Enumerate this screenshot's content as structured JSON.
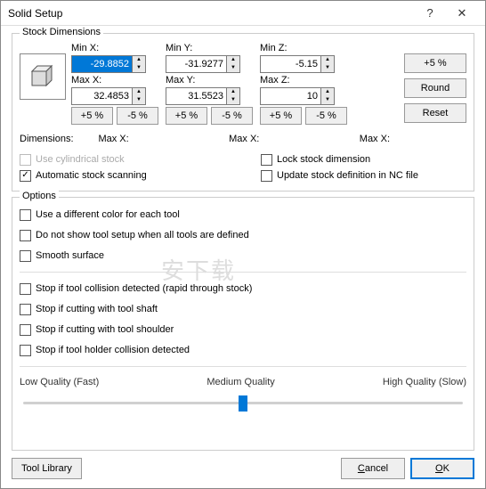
{
  "window": {
    "title": "Solid Setup",
    "help": "?",
    "close": "✕"
  },
  "stock": {
    "group_label": "Stock Dimensions",
    "minx_label": "Min X:",
    "minx": "-29.8852",
    "miny_label": "Min Y:",
    "miny": "-31.9277",
    "minz_label": "Min Z:",
    "minz": "-5.15",
    "maxx_label": "Max X:",
    "maxx": "32.4853",
    "maxy_label": "Max Y:",
    "maxy": "31.5523",
    "maxz_label": "Max Z:",
    "maxz": "10",
    "plus5": "+5 %",
    "minus5": "-5 %",
    "btn_plus5": "+5 %",
    "btn_round": "Round",
    "btn_reset": "Reset",
    "dimensions_label": "Dimensions:",
    "dim_maxx": "Max X:",
    "dim_maxy": "Max X:",
    "dim_maxz": "Max X:",
    "use_cyl": "Use cylindrical stock",
    "auto_scan": "Automatic stock scanning",
    "lock": "Lock stock dimension",
    "update_nc": "Update stock definition in NC file"
  },
  "options": {
    "group_label": "Options",
    "diff_color": "Use a different color for each tool",
    "no_show_setup": "Do not show tool setup when all tools are defined",
    "smooth": "Smooth surface",
    "stop_rapid": "Stop if tool collision detected (rapid through stock)",
    "stop_shaft": "Stop if cutting with tool shaft",
    "stop_shoulder": "Stop if cutting with tool shoulder",
    "stop_holder": "Stop if tool holder collision detected",
    "q_low": "Low Quality (Fast)",
    "q_med": "Medium Quality",
    "q_high": "High Quality (Slow)"
  },
  "footer": {
    "tool_lib": "Tool Library",
    "cancel_pre": "",
    "cancel_accel": "C",
    "cancel_post": "ancel",
    "ok_pre": "",
    "ok_accel": "O",
    "ok_post": "K"
  },
  "watermark": "安下载"
}
